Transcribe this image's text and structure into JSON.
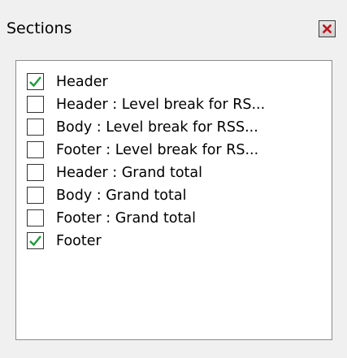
{
  "panel": {
    "title": "Sections",
    "close_icon": "close-icon"
  },
  "colors": {
    "panel_background": "#f0f0f0",
    "list_background": "#ffffff",
    "check_mark": "#1f9a3a",
    "close_x": "#c0141c"
  },
  "sections": {
    "items": [
      {
        "label": "Header",
        "checked": true
      },
      {
        "label": "Header : Level break for RS...",
        "checked": false
      },
      {
        "label": "Body : Level break for RSS...",
        "checked": false
      },
      {
        "label": "Footer : Level break for RS...",
        "checked": false
      },
      {
        "label": "Header : Grand total",
        "checked": false
      },
      {
        "label": "Body : Grand total",
        "checked": false
      },
      {
        "label": "Footer : Grand total",
        "checked": false
      },
      {
        "label": "Footer",
        "checked": true
      }
    ]
  }
}
